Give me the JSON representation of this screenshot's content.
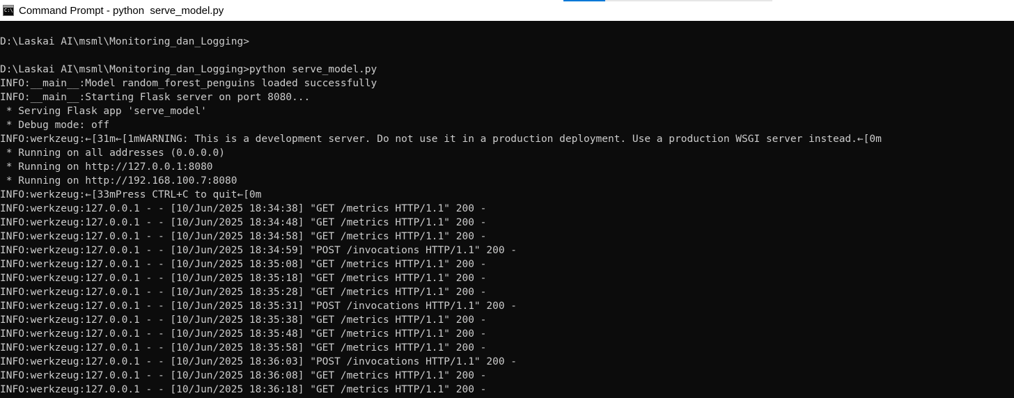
{
  "window": {
    "title": "Command Prompt - python  serve_model.py",
    "icon": "cmd-icon",
    "icon_glyph": "C:\\."
  },
  "console": {
    "lines": [
      "D:\\Laskai AI\\msml\\Monitoring_dan_Logging>",
      "",
      "D:\\Laskai AI\\msml\\Monitoring_dan_Logging>python serve_model.py",
      "INFO:__main__:Model random_forest_penguins loaded successfully",
      "INFO:__main__:Starting Flask server on port 8080...",
      " * Serving Flask app 'serve_model'",
      " * Debug mode: off",
      "INFO:werkzeug:←[31m←[1mWARNING: This is a development server. Do not use it in a production deployment. Use a production WSGI server instead.←[0m",
      " * Running on all addresses (0.0.0.0)",
      " * Running on http://127.0.0.1:8080",
      " * Running on http://192.168.100.7:8080",
      "INFO:werkzeug:←[33mPress CTRL+C to quit←[0m",
      "INFO:werkzeug:127.0.0.1 - - [10/Jun/2025 18:34:38] \"GET /metrics HTTP/1.1\" 200 -",
      "INFO:werkzeug:127.0.0.1 - - [10/Jun/2025 18:34:48] \"GET /metrics HTTP/1.1\" 200 -",
      "INFO:werkzeug:127.0.0.1 - - [10/Jun/2025 18:34:58] \"GET /metrics HTTP/1.1\" 200 -",
      "INFO:werkzeug:127.0.0.1 - - [10/Jun/2025 18:34:59] \"POST /invocations HTTP/1.1\" 200 -",
      "INFO:werkzeug:127.0.0.1 - - [10/Jun/2025 18:35:08] \"GET /metrics HTTP/1.1\" 200 -",
      "INFO:werkzeug:127.0.0.1 - - [10/Jun/2025 18:35:18] \"GET /metrics HTTP/1.1\" 200 -",
      "INFO:werkzeug:127.0.0.1 - - [10/Jun/2025 18:35:28] \"GET /metrics HTTP/1.1\" 200 -",
      "INFO:werkzeug:127.0.0.1 - - [10/Jun/2025 18:35:31] \"POST /invocations HTTP/1.1\" 200 -",
      "INFO:werkzeug:127.0.0.1 - - [10/Jun/2025 18:35:38] \"GET /metrics HTTP/1.1\" 200 -",
      "INFO:werkzeug:127.0.0.1 - - [10/Jun/2025 18:35:48] \"GET /metrics HTTP/1.1\" 200 -",
      "INFO:werkzeug:127.0.0.1 - - [10/Jun/2025 18:35:58] \"GET /metrics HTTP/1.1\" 200 -",
      "INFO:werkzeug:127.0.0.1 - - [10/Jun/2025 18:36:03] \"POST /invocations HTTP/1.1\" 200 -",
      "INFO:werkzeug:127.0.0.1 - - [10/Jun/2025 18:36:08] \"GET /metrics HTTP/1.1\" 200 -",
      "INFO:werkzeug:127.0.0.1 - - [10/Jun/2025 18:36:18] \"GET /metrics HTTP/1.1\" 200 -"
    ]
  },
  "colors": {
    "console_background": "#0c0c0c",
    "console_text": "#cccccc",
    "titlebar_background": "#ffffff",
    "accent": "#0078d7"
  }
}
